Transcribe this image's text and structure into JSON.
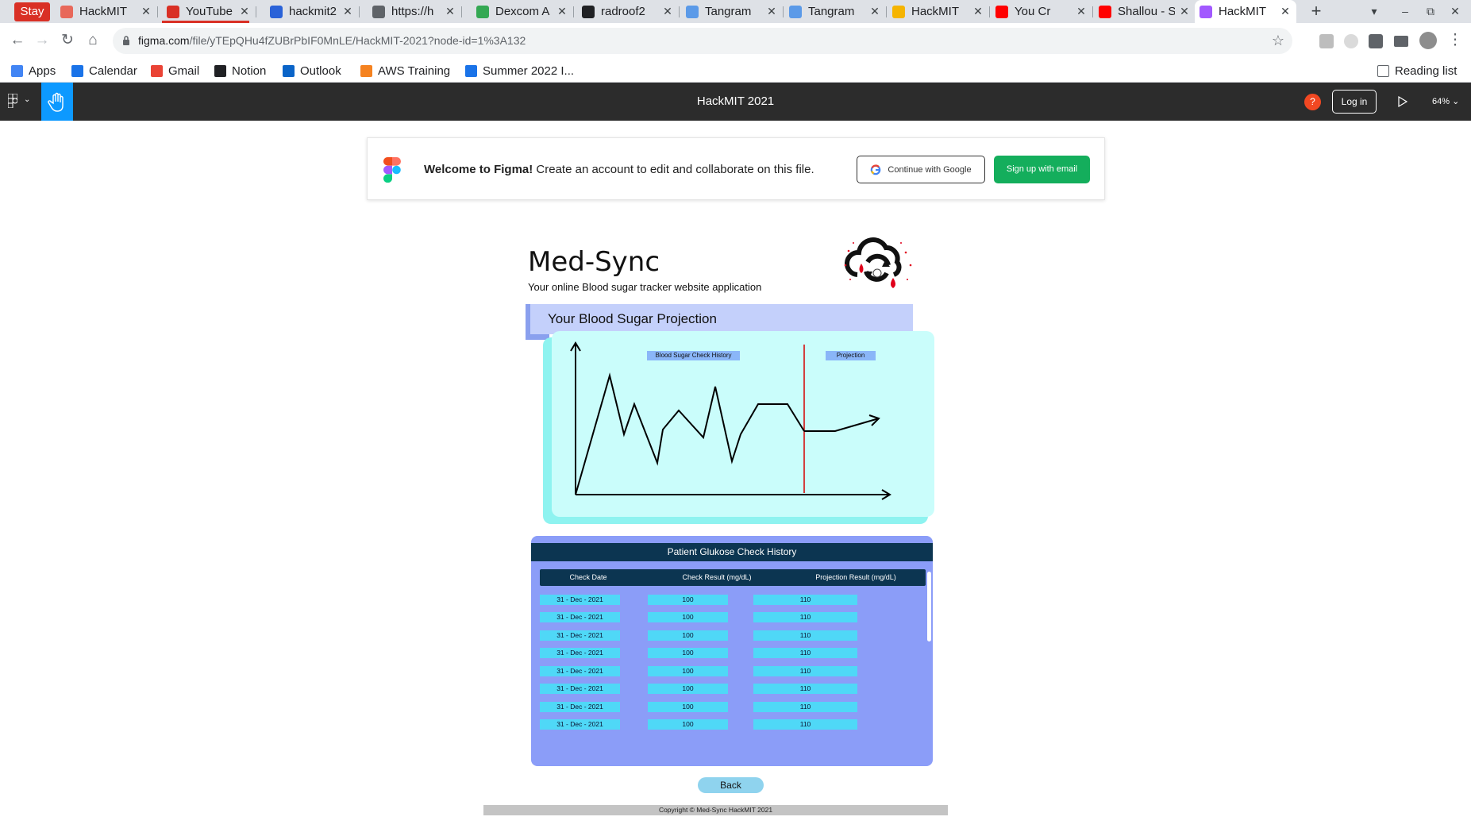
{
  "browser": {
    "stay_label": "Stay",
    "tabs": [
      {
        "label": "HackMIT",
        "color": "#e8685a"
      },
      {
        "label": "YouTube",
        "color": "#d93025"
      },
      {
        "label": "hackmit2",
        "color": "#2a62d8"
      },
      {
        "label": "https://h",
        "color": "#5f6368"
      },
      {
        "label": "Dexcom A",
        "color": "#34a853"
      },
      {
        "label": "radroof2",
        "color": "#202124"
      },
      {
        "label": "Tangram",
        "color": "#5b9ae8"
      },
      {
        "label": "Tangram",
        "color": "#5b9ae8"
      },
      {
        "label": "HackMIT",
        "color": "#f5b400"
      },
      {
        "label": "You Cr",
        "color": "#ff0000"
      },
      {
        "label": "Shallou - S",
        "color": "#ff0000"
      },
      {
        "label": "HackMIT",
        "color": "#a259ff"
      }
    ],
    "url_host": "figma.com",
    "url_path": "/file/yTEpQHu4fZUBrPbIF0MnLE/HackMIT-2021?node-id=1%3A132",
    "bookmarks": [
      {
        "label": "Apps",
        "color": "#4285f4"
      },
      {
        "label": "Calendar",
        "color": "#1a73e8"
      },
      {
        "label": "Gmail",
        "color": "#ea4335"
      },
      {
        "label": "Notion",
        "color": "#202124"
      },
      {
        "label": "Outlook",
        "color": "#0a64c8"
      },
      {
        "label": "AWS Training",
        "color": "#f58220"
      },
      {
        "label": "Summer 2022 I...",
        "color": "#1a73e8"
      }
    ],
    "reading_list": "Reading list"
  },
  "figma": {
    "file_title": "HackMIT 2021",
    "help_label": "?",
    "login_label": "Log in",
    "zoom": "64%",
    "welcome_bold": "Welcome to Figma!",
    "welcome_text": " Create an account to edit and collaborate on this file.",
    "google_button": "Continue with Google",
    "email_button": "Sign up with email"
  },
  "app": {
    "title": "Med-Sync",
    "subtitle": "Your online Blood sugar tracker website application",
    "section_title": "Your Blood Sugar Projection",
    "legend_history": "Blood Sugar Check History",
    "legend_projection": "Projection",
    "table_title": "Patient Glukose Check History",
    "columns": [
      "Check Date",
      "Check Result (mg/dL)",
      "Projection Result (mg/dL)"
    ],
    "rows": [
      [
        "31 - Dec - 2021",
        "100",
        "110"
      ],
      [
        "31 - Dec - 2021",
        "100",
        "110"
      ],
      [
        "31 - Dec - 2021",
        "100",
        "110"
      ],
      [
        "31 - Dec - 2021",
        "100",
        "110"
      ],
      [
        "31 - Dec - 2021",
        "100",
        "110"
      ],
      [
        "31 - Dec - 2021",
        "100",
        "110"
      ],
      [
        "31 - Dec - 2021",
        "100",
        "110"
      ],
      [
        "31 - Dec - 2021",
        "100",
        "110"
      ]
    ],
    "back_label": "Back",
    "footer": "Copyright © Med-Sync HackMIT 2021"
  },
  "colors": {
    "figma_green": "#14ae5c",
    "figma_blue": "#0d99ff",
    "table_bg": "#8b9df8",
    "table_header": "#0c3551",
    "cell": "#4fd8f7",
    "chart_bg": "#cafdfb",
    "divider": "#d40000"
  }
}
